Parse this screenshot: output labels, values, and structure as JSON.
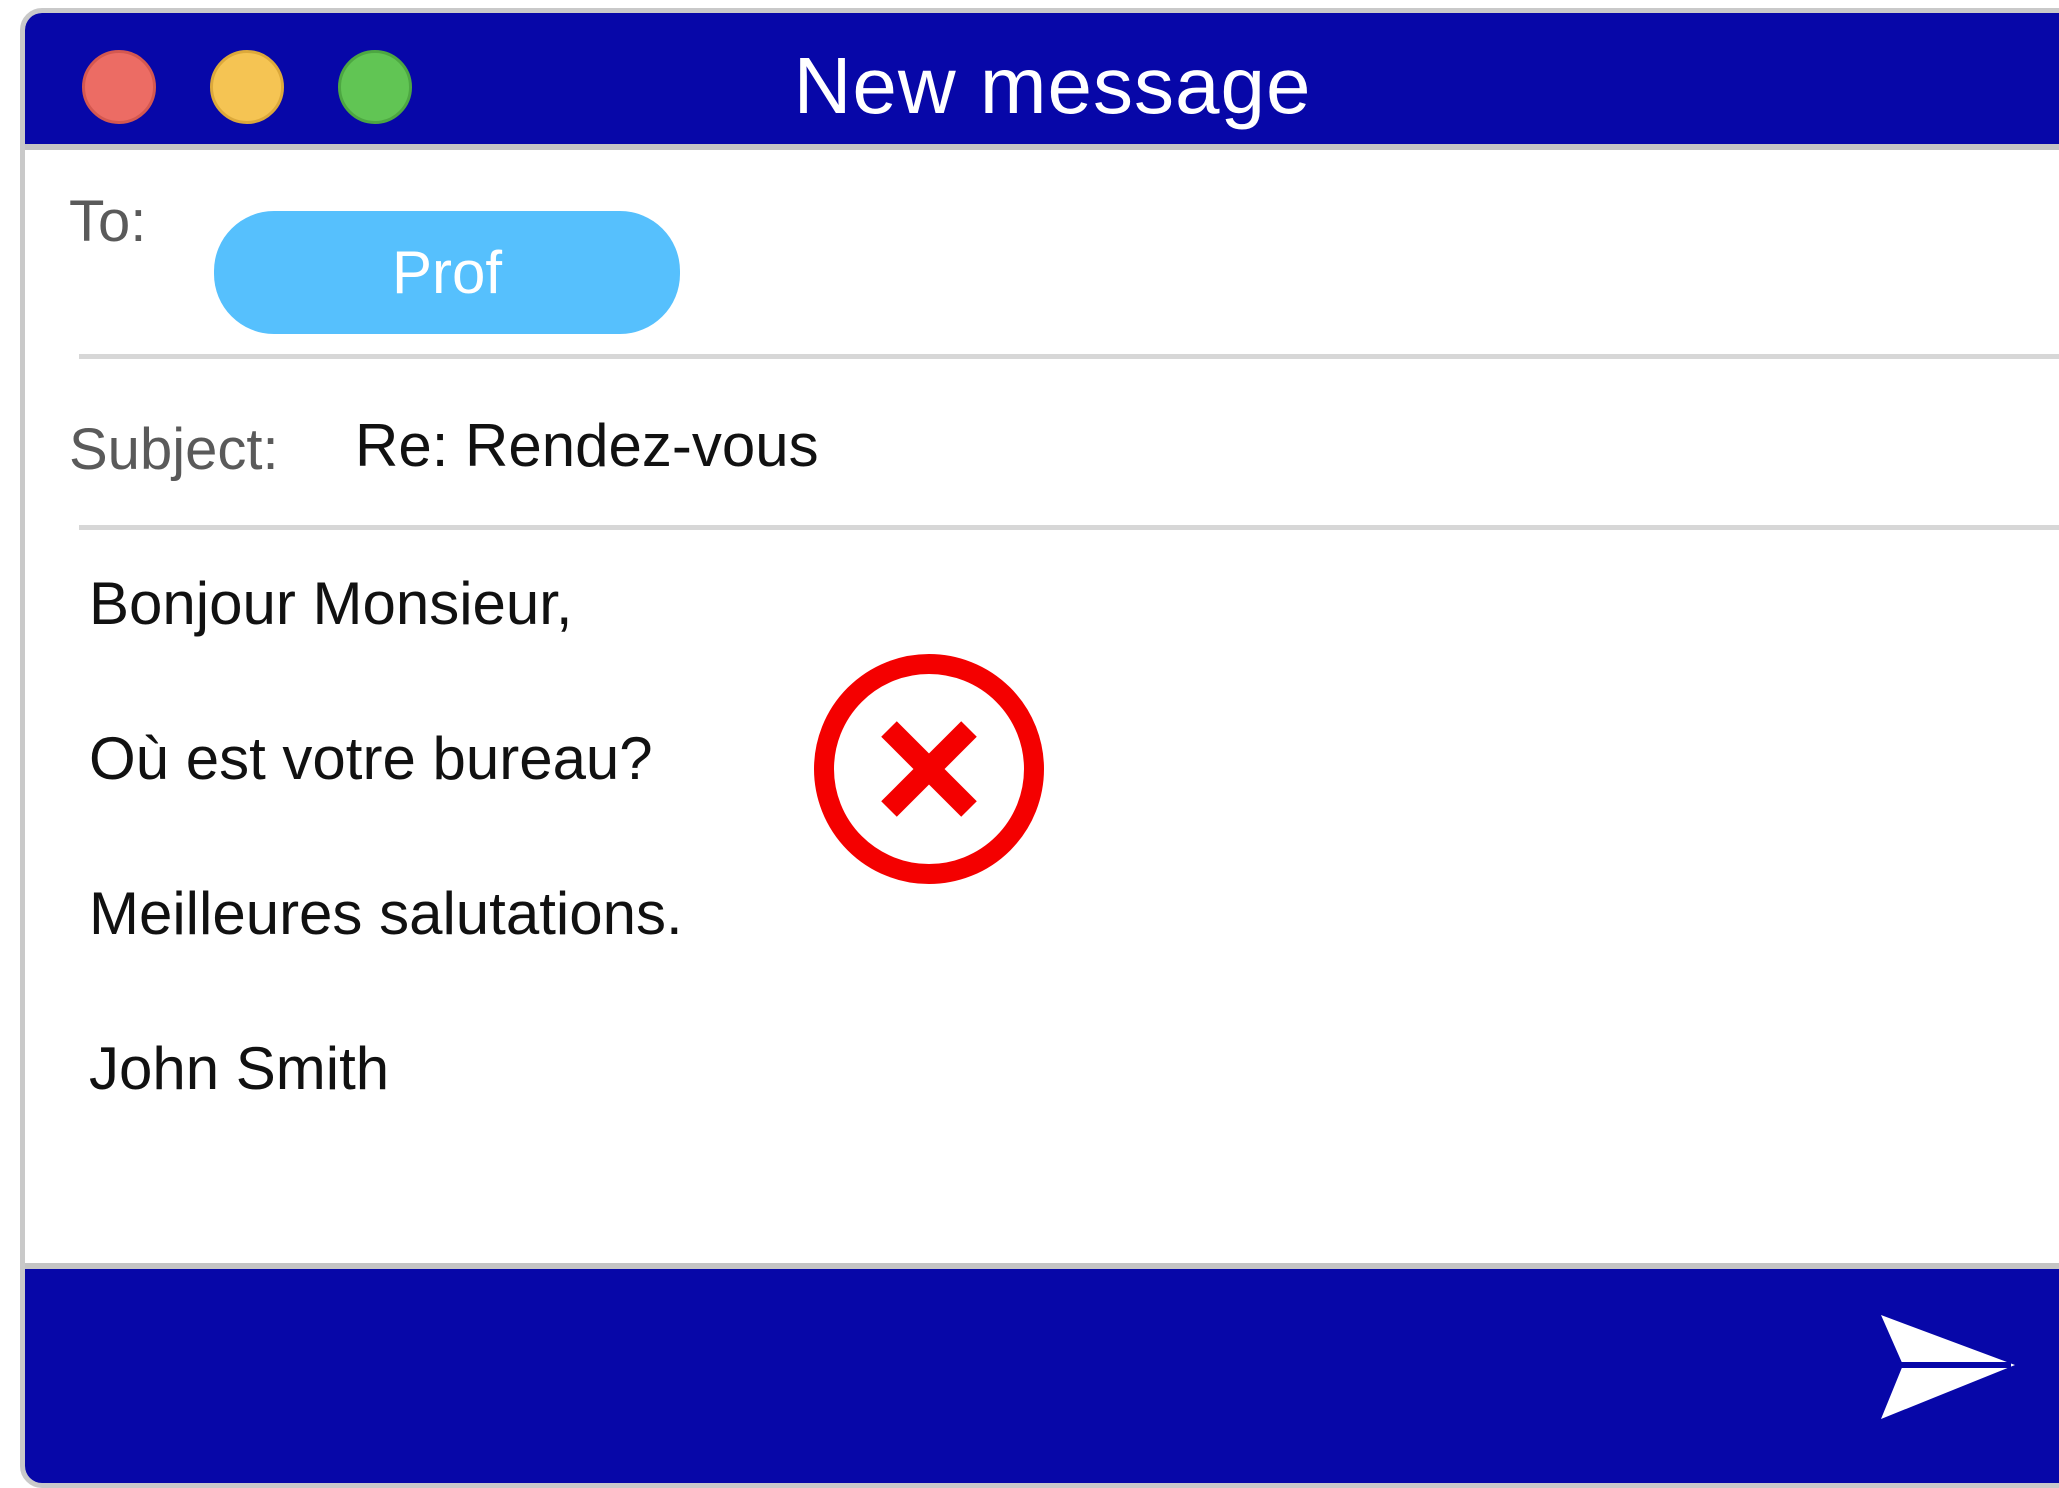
{
  "window": {
    "title": "New message",
    "controls": [
      "close",
      "minimize",
      "zoom"
    ]
  },
  "to": {
    "label": "To:",
    "recipient": "Prof"
  },
  "subject": {
    "label": "Subject:",
    "value": "Re: Rendez-vous"
  },
  "body": {
    "lines": [
      "Bonjour Monsieur,",
      "Où est votre bureau?",
      "Meilleures salutations.",
      "John Smith"
    ]
  },
  "indicator": {
    "icon": "error-x-circle-icon",
    "color": "#f40000"
  },
  "footer": {
    "send_icon": "send-icon"
  },
  "colors": {
    "accent": "#0707a8",
    "chip": "#56c0fd",
    "close": "#ec6c64",
    "minimize": "#f5c453",
    "zoom": "#61c554"
  }
}
